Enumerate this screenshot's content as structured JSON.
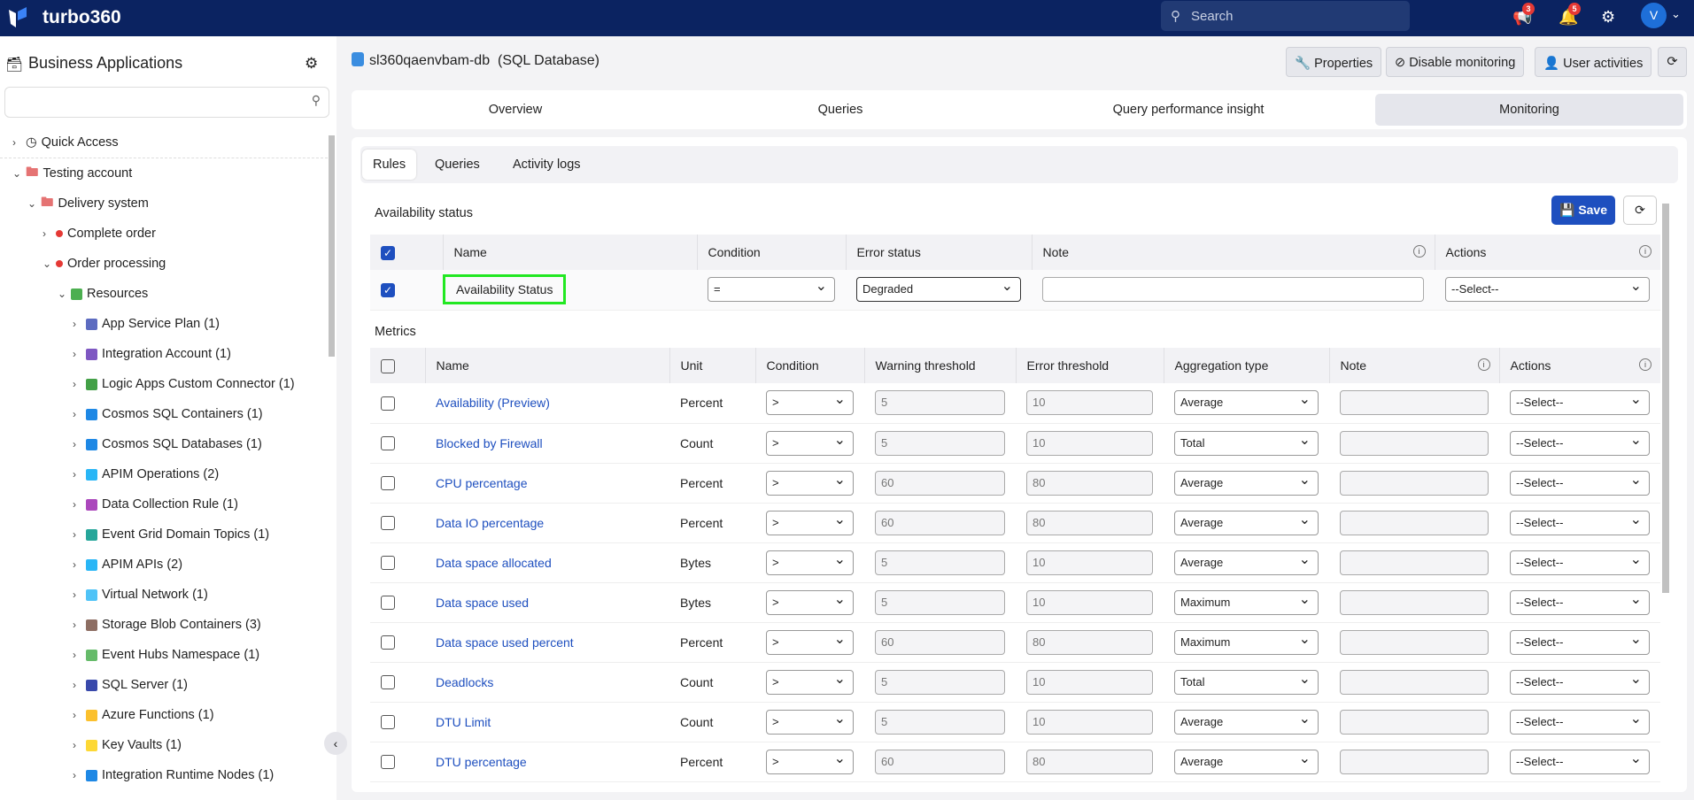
{
  "app": {
    "name": "turbo360",
    "search_placeholder": "Search",
    "announcements_count": "3",
    "notifications_count": "5",
    "avatar_initial": "V"
  },
  "sidebar": {
    "title": "Business Applications",
    "quick_access": "Quick Access",
    "tree": [
      {
        "label": "Testing account",
        "level": 0,
        "icon": "folder"
      },
      {
        "label": "Delivery system",
        "level": 1,
        "icon": "folder"
      },
      {
        "label": "Complete order",
        "level": 2,
        "icon": "red-dot"
      },
      {
        "label": "Order processing",
        "level": 2,
        "icon": "red-dot"
      },
      {
        "label": "Resources",
        "level": 3,
        "icon": "grid"
      },
      {
        "label": "App Service Plan (1)",
        "level": 4,
        "icon": "app-service-plan"
      },
      {
        "label": "Integration Account (1)",
        "level": 4,
        "icon": "integration-account"
      },
      {
        "label": "Logic Apps Custom Connector (1)",
        "level": 4,
        "icon": "logic-apps-connector"
      },
      {
        "label": "Cosmos SQL Containers (1)",
        "level": 4,
        "icon": "cosmos"
      },
      {
        "label": "Cosmos SQL Databases (1)",
        "level": 4,
        "icon": "cosmos"
      },
      {
        "label": "APIM Operations (2)",
        "level": 4,
        "icon": "apim"
      },
      {
        "label": "Data Collection Rule (1)",
        "level": 4,
        "icon": "data-collection-rule"
      },
      {
        "label": "Event Grid Domain Topics (1)",
        "level": 4,
        "icon": "event-grid"
      },
      {
        "label": "APIM APIs (2)",
        "level": 4,
        "icon": "apim"
      },
      {
        "label": "Virtual Network (1)",
        "level": 4,
        "icon": "virtual-network"
      },
      {
        "label": "Storage Blob Containers (3)",
        "level": 4,
        "icon": "storage"
      },
      {
        "label": "Event Hubs Namespace (1)",
        "level": 4,
        "icon": "event-hubs"
      },
      {
        "label": "SQL Server (1)",
        "level": 4,
        "icon": "sql-server"
      },
      {
        "label": "Azure Functions (1)",
        "level": 4,
        "icon": "functions"
      },
      {
        "label": "Key Vaults (1)",
        "level": 4,
        "icon": "key-vault"
      },
      {
        "label": "Integration Runtime Nodes (1)",
        "level": 4,
        "icon": "integration-runtime"
      }
    ]
  },
  "resource": {
    "name": "sl360qaenvbam-db",
    "type": "(SQL Database)"
  },
  "toolbar": {
    "properties": "Properties",
    "disable_monitoring": "Disable monitoring",
    "user_activities": "User activities"
  },
  "tabs": [
    "Overview",
    "Queries",
    "Query performance insight",
    "Monitoring"
  ],
  "subtabs": [
    "Rules",
    "Queries",
    "Activity logs"
  ],
  "availability": {
    "title": "Availability status",
    "save": "Save",
    "headers": [
      "Name",
      "Condition",
      "Error status",
      "Note",
      "Actions"
    ],
    "row": {
      "name": "Availability Status",
      "condition": "=",
      "error_status": "Degraded",
      "note": "",
      "action": "--Select--"
    }
  },
  "metrics": {
    "title": "Metrics",
    "headers": [
      "Name",
      "Unit",
      "Condition",
      "Warning threshold",
      "Error threshold",
      "Aggregation type",
      "Note",
      "Actions"
    ],
    "rows": [
      {
        "name": "Availability (Preview)",
        "unit": "Percent",
        "condition": ">",
        "warning": "5",
        "error": "10",
        "aggregation": "Average",
        "action": "--Select--"
      },
      {
        "name": "Blocked by Firewall",
        "unit": "Count",
        "condition": ">",
        "warning": "5",
        "error": "10",
        "aggregation": "Total",
        "action": "--Select--"
      },
      {
        "name": "CPU percentage",
        "unit": "Percent",
        "condition": ">",
        "warning": "60",
        "error": "80",
        "aggregation": "Average",
        "action": "--Select--"
      },
      {
        "name": "Data IO percentage",
        "unit": "Percent",
        "condition": ">",
        "warning": "60",
        "error": "80",
        "aggregation": "Average",
        "action": "--Select--"
      },
      {
        "name": "Data space allocated",
        "unit": "Bytes",
        "condition": ">",
        "warning": "5",
        "error": "10",
        "aggregation": "Average",
        "action": "--Select--"
      },
      {
        "name": "Data space used",
        "unit": "Bytes",
        "condition": ">",
        "warning": "5",
        "error": "10",
        "aggregation": "Maximum",
        "action": "--Select--"
      },
      {
        "name": "Data space used percent",
        "unit": "Percent",
        "condition": ">",
        "warning": "60",
        "error": "80",
        "aggregation": "Maximum",
        "action": "--Select--"
      },
      {
        "name": "Deadlocks",
        "unit": "Count",
        "condition": ">",
        "warning": "5",
        "error": "10",
        "aggregation": "Total",
        "action": "--Select--"
      },
      {
        "name": "DTU Limit",
        "unit": "Count",
        "condition": ">",
        "warning": "5",
        "error": "10",
        "aggregation": "Average",
        "action": "--Select--"
      },
      {
        "name": "DTU percentage",
        "unit": "Percent",
        "condition": ">",
        "warning": "60",
        "error": "80",
        "aggregation": "Average",
        "action": "--Select--"
      }
    ]
  },
  "colors": {
    "header_bg": "#0b2361",
    "accent": "#1e4fbf",
    "highlight": "#22e822",
    "badge": "#e53935"
  }
}
